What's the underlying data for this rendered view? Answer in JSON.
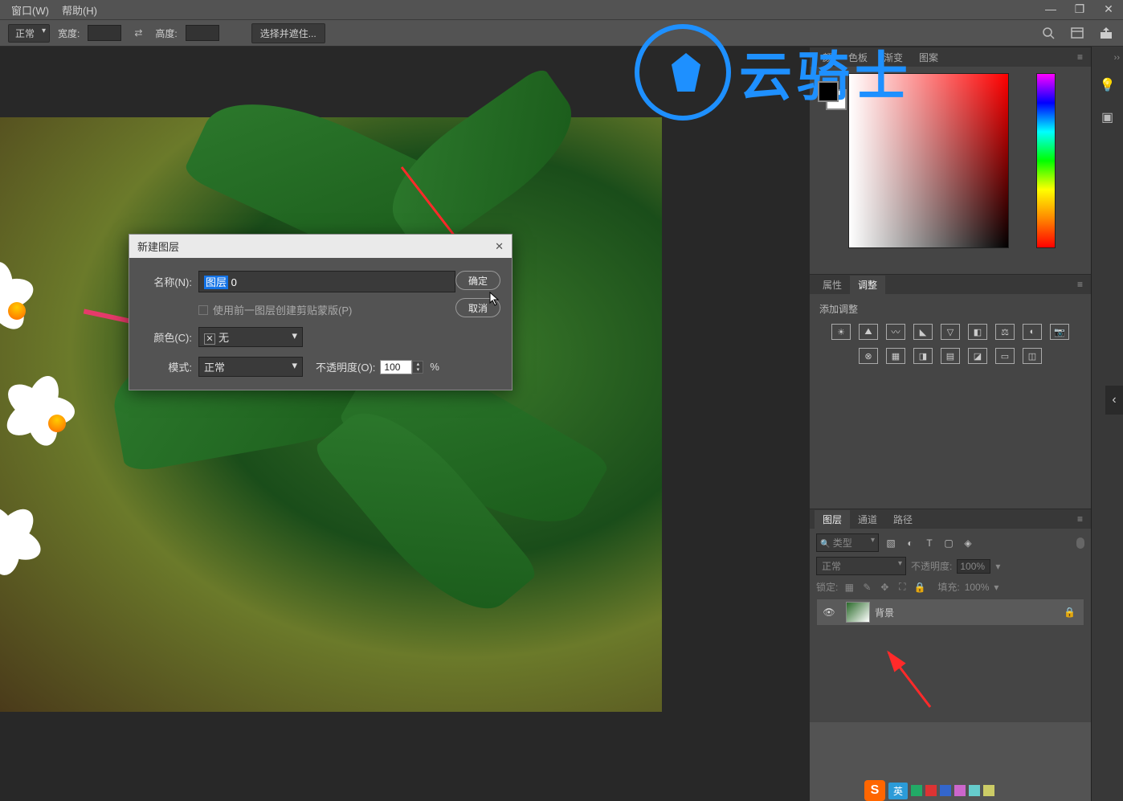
{
  "menu": {
    "window": "窗口(W)",
    "help": "帮助(H)"
  },
  "options": {
    "blend_mode": "正常",
    "width_label": "宽度:",
    "height_label": "高度:",
    "select_and_mask": "选择并遮住..."
  },
  "dialog": {
    "title": "新建图层",
    "name_label": "名称(N):",
    "name_value_selected": "图层",
    "name_value_rest": " 0",
    "clip_label": "使用前一图层创建剪贴蒙版(P)",
    "color_label": "颜色(C):",
    "color_value": "无",
    "mode_label": "模式:",
    "mode_value": "正常",
    "opacity_label": "不透明度(O):",
    "opacity_value": "100",
    "percent": "%",
    "ok": "确定",
    "cancel": "取消"
  },
  "panels": {
    "color": {
      "tab1": "颜",
      "tab2": "色板",
      "tab3": "渐变",
      "tab4": "图案"
    },
    "adjust": {
      "tab_properties": "属性",
      "tab_adjust": "调整",
      "add_label": "添加调整"
    },
    "layers": {
      "tab_layers": "图层",
      "tab_channels": "通道",
      "tab_paths": "路径",
      "search_kind": "类型",
      "blend": "正常",
      "opacity_label": "不透明度:",
      "opacity_value": "100%",
      "lock_label": "锁定:",
      "fill_label": "填充:",
      "fill_value": "100%",
      "layer_name": "背景"
    }
  },
  "watermark": "云骑士"
}
